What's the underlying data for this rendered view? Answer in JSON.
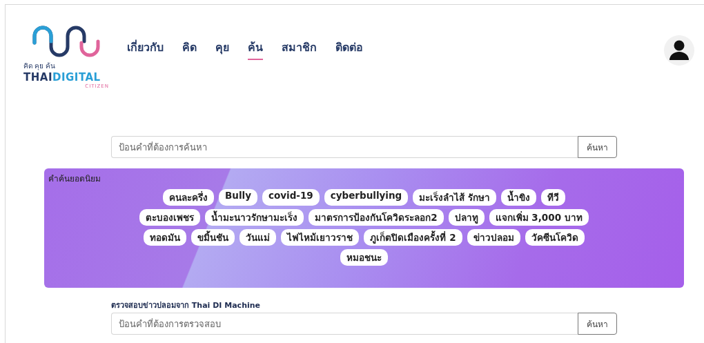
{
  "logo": {
    "tagline": "คิด คุย ค้น",
    "brand_dark": "THAI",
    "brand_light": "DIGITAL",
    "sub": "CITIZEN"
  },
  "nav": [
    {
      "label": "เกี่ยวกับ",
      "selected": false
    },
    {
      "label": "คิด",
      "selected": false
    },
    {
      "label": "คุย",
      "selected": false
    },
    {
      "label": "ค้น",
      "selected": true
    },
    {
      "label": "สมาชิก",
      "selected": false
    },
    {
      "label": "ติดต่อ",
      "selected": false
    }
  ],
  "search": {
    "placeholder": "ป้อนคำที่ต้องการค้นหา",
    "button": "ค้นหา"
  },
  "popular": {
    "title": "คำค้นยอดนิยม",
    "tags": [
      "คนละครึ่ง",
      "Bully",
      "covid-19",
      "cyberbullying",
      "มะเร็งลำไส้ รักษา",
      "น้ำขิง",
      "ทีวี",
      "ตะบองเพชร",
      "น้ำมะนาวรักษามะเร็ง",
      "มาตรการป้องกันโควิดระลอก2",
      "ปลาทู",
      "แจกเพิ่ม 3,000 บาท",
      "ทอดมัน",
      "ขมิ้นชัน",
      "วันแม่",
      "ไฟไหม้เยาวราช",
      "ภูเก็ตปิดเมืองครั้งที่ 2",
      "ข่าวปลอม",
      "วัคซีนโควิด",
      "หมอชนะ"
    ]
  },
  "fact_check": {
    "label": "ตรวจสอบข่าวปลอมจาก Thai DI Machine",
    "placeholder": "ป้อนคำที่ต้องการตรวจสอบ",
    "button": "ค้นหา"
  }
}
